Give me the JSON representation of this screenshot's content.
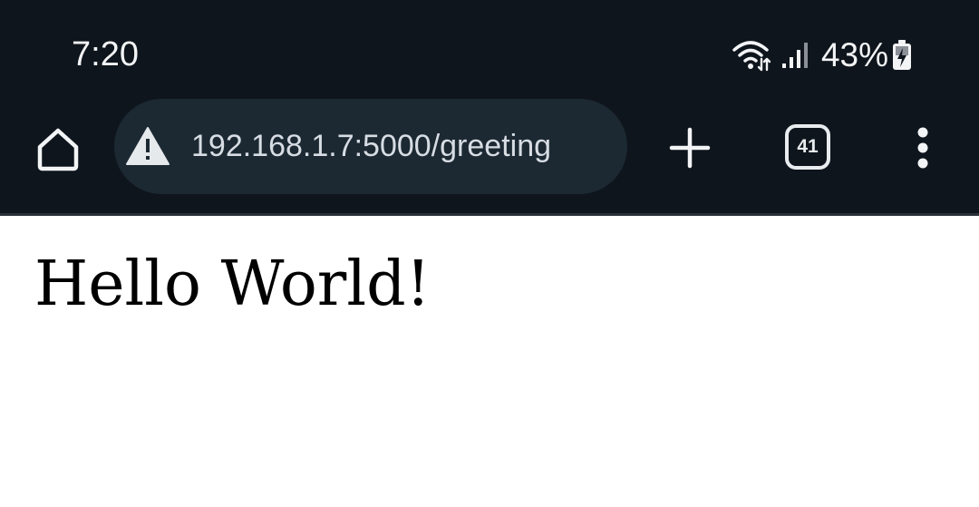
{
  "status_bar": {
    "time": "7:20",
    "battery_percent": "43%",
    "icons": [
      "wifi-icon",
      "cellular-signal-icon",
      "battery-charging-icon"
    ]
  },
  "toolbar": {
    "url": "192.168.1.7:5000/greeting",
    "security_icon": "warning-icon",
    "tab_count": "41",
    "icons": [
      "home-icon",
      "plus-icon",
      "tabs-icon",
      "more-vert-icon"
    ]
  },
  "page": {
    "heading": "Hello World!"
  },
  "colors": {
    "chrome_background": "#0f151c",
    "url_pill_background": "#1c2933",
    "page_background": "#ffffff"
  }
}
